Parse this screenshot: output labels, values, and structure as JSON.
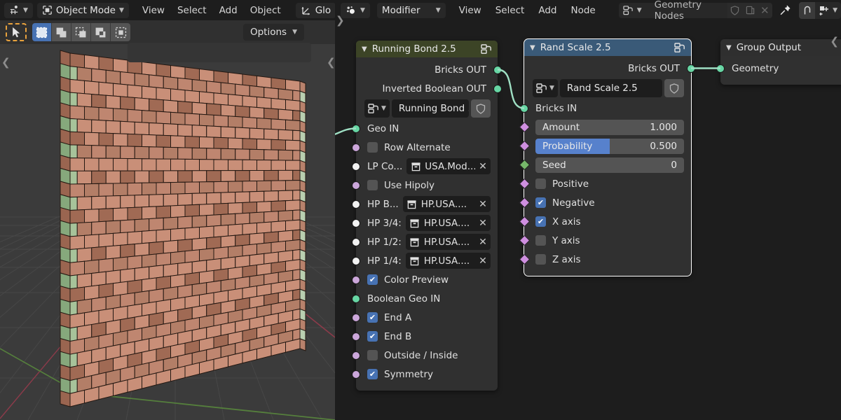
{
  "viewport": {
    "header": {
      "editor_type_icon": "editor-type-3dview-icon",
      "mode": "Object Mode",
      "menus": [
        "View",
        "Select",
        "Add",
        "Object"
      ],
      "transform_orientation": "Glo",
      "transform_icon": "orientation-gizmo-icon"
    },
    "toolbar": {
      "active_tool_icon": "tweak-cursor-icon",
      "select_modes": [
        "select-box-icon",
        "select-extend-icon",
        "select-subtract-icon",
        "select-invert-icon",
        "select-intersect-icon"
      ],
      "options_label": "Options"
    },
    "scene": {
      "object": "brick wall",
      "brick_color": "#c98f78",
      "brick_color_dark": "#a06a54",
      "brick_color_accent": "#a7c39a",
      "background": "#3b3b3b",
      "axis_x_color": "#8c3b4a",
      "axis_y_color": "#557f3c"
    }
  },
  "node_editor": {
    "header": {
      "editor_type_icon": "editor-type-geometrynodes-icon",
      "context": "Modifier",
      "menus": [
        "View",
        "Select",
        "Add",
        "Node"
      ],
      "datablock_icon": "nodetree-icon",
      "datablock_name": "Geometry Nodes",
      "shield_icon": "fake-user-icon",
      "copy_icon": "duplicate-icon",
      "close_icon": "unlink-icon",
      "pin_icon": "pin-icon",
      "snap_icon": "snap-icon",
      "snap_target_icon": "snap-target-icon"
    },
    "nodes": [
      {
        "id": "running-bond",
        "title": "Running Bond 2.5",
        "header_color": "#3c4426",
        "selected": false,
        "collapse_icon": "chevron-down-icon",
        "group_icon": "node-group-icon",
        "outputs": [
          {
            "label": "Bricks OUT",
            "socket": "geometry"
          },
          {
            "label": "Inverted Boolean OUT",
            "socket": "geometry"
          }
        ],
        "datablock": {
          "browse_icon": "node-group-icon",
          "name": "Running Bond ...",
          "shield_icon": "fake-user-icon"
        },
        "inputs": [
          {
            "type": "socket-label",
            "label": "Geo IN",
            "socket": "geometry"
          },
          {
            "type": "checkbox",
            "label": "Row Alternate",
            "checked": false,
            "socket": "boolean"
          },
          {
            "type": "object",
            "label": "LP Co...",
            "value": "USA.Mod...",
            "socket": "object",
            "icon": "collection-icon"
          },
          {
            "type": "checkbox",
            "label": "Use Hipoly",
            "checked": false,
            "socket": "boolean"
          },
          {
            "type": "object",
            "label": "HP B...",
            "value": "HP.USA....",
            "socket": "object",
            "icon": "collection-icon"
          },
          {
            "type": "object",
            "label": "HP 3/4:",
            "value": "HP.USA....",
            "socket": "object",
            "icon": "collection-icon"
          },
          {
            "type": "object",
            "label": "HP 1/2:",
            "value": "HP.USA....",
            "socket": "object",
            "icon": "collection-icon"
          },
          {
            "type": "object",
            "label": "HP 1/4:",
            "value": "HP.USA....",
            "socket": "object",
            "icon": "collection-icon"
          },
          {
            "type": "checkbox",
            "label": "Color Preview",
            "checked": true,
            "socket": "boolean"
          },
          {
            "type": "socket-label",
            "label": "Boolean Geo IN",
            "socket": "geometry"
          },
          {
            "type": "checkbox",
            "label": "End A",
            "checked": true,
            "socket": "boolean"
          },
          {
            "type": "checkbox",
            "label": "End B",
            "checked": true,
            "socket": "boolean"
          },
          {
            "type": "checkbox",
            "label": "Outside / Inside",
            "checked": false,
            "socket": "boolean"
          },
          {
            "type": "checkbox",
            "label": "Symmetry",
            "checked": true,
            "socket": "boolean"
          }
        ]
      },
      {
        "id": "rand-scale",
        "title": "Rand Scale 2.5",
        "header_color": "#3a5a78",
        "selected": true,
        "collapse_icon": "chevron-down-icon",
        "group_icon": "node-group-icon",
        "outputs": [
          {
            "label": "Bricks OUT",
            "socket": "geometry"
          }
        ],
        "datablock": {
          "browse_icon": "node-group-icon",
          "name": "Rand Scale 2.5",
          "shield_icon": "fake-user-icon"
        },
        "inputs": [
          {
            "type": "socket-label",
            "label": "Bricks IN",
            "socket": "geometry"
          },
          {
            "type": "value",
            "label": "Amount",
            "value": "1.000",
            "fill": 0,
            "socket": "field"
          },
          {
            "type": "value",
            "label": "Probability",
            "value": "0.500",
            "fill": 50,
            "socket": "field"
          },
          {
            "type": "value",
            "label": "Seed",
            "value": "0",
            "fill": 0,
            "socket": "field-int"
          },
          {
            "type": "checkbox",
            "label": "Positive",
            "checked": false,
            "socket": "field"
          },
          {
            "type": "checkbox",
            "label": "Negative",
            "checked": true,
            "socket": "field"
          },
          {
            "type": "checkbox",
            "label": "X axis",
            "checked": true,
            "socket": "field"
          },
          {
            "type": "checkbox",
            "label": "Y axis",
            "checked": false,
            "socket": "field"
          },
          {
            "type": "checkbox",
            "label": "Z axis",
            "checked": false,
            "socket": "field"
          }
        ]
      },
      {
        "id": "group-output",
        "title": "Group Output",
        "header_color": "#2f2f2f",
        "selected": false,
        "collapse_icon": "chevron-down-icon",
        "outputs": [],
        "inputs": [
          {
            "type": "socket-label",
            "label": "Geometry",
            "socket": "geometry"
          }
        ]
      }
    ],
    "socket_colors": {
      "geometry": "#67d6a4",
      "boolean": "#cba6da",
      "object": "#f2f2f2",
      "field": "#cf8fe0",
      "field_int": "#76b86a"
    }
  }
}
